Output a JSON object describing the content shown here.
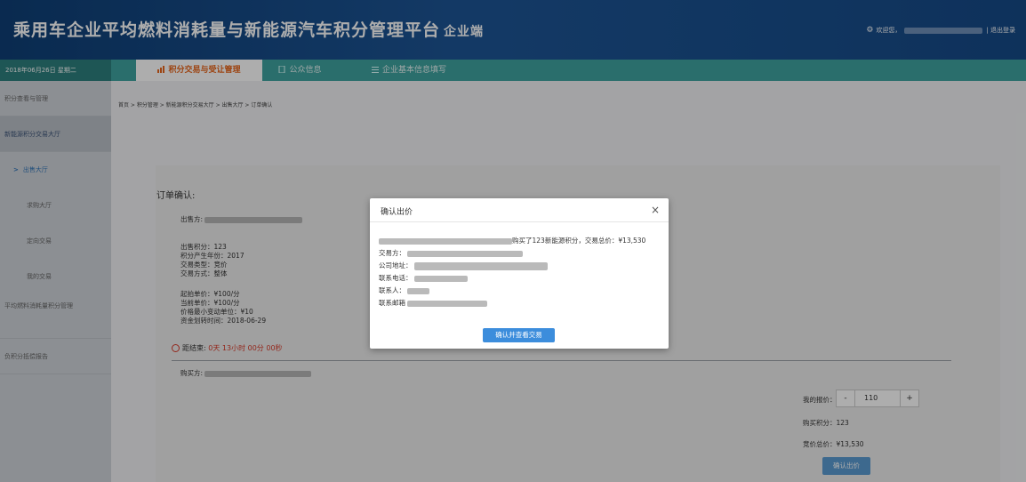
{
  "header": {
    "title": "乘用车企业平均燃料消耗量与新能源汽车积分管理平台",
    "subtitle": "企业端",
    "welcome": "欢迎您，",
    "logout": "| 退出登录"
  },
  "nav": {
    "date": "2018年06月26日 星期二",
    "tabs": [
      {
        "label": "积分交易与受让管理"
      },
      {
        "label": "公众信息"
      },
      {
        "label": "企业基本信息填写"
      }
    ]
  },
  "sidebar": {
    "items": [
      "积分查看与管理",
      "新能源积分交易大厅",
      "出售大厅",
      "求购大厅",
      "定向交易",
      "我的交易",
      "平均燃料消耗量积分管理",
      "负积分抵偿报告"
    ]
  },
  "breadcrumb": "首页 > 积分管理 > 新能源积分交易大厅 > 出售大厅 > 订单确认",
  "order": {
    "heading": "订单确认:",
    "seller_label": "出售方:",
    "credits": "出售积分：123",
    "year": "积分产生年份：2017",
    "trade_type": "交易类型：竞价",
    "trade_mode": "交易方式：整体",
    "start_price": "起拍单价：¥100/分",
    "current_price": "当前单价：¥100/分",
    "min_step": "价格最小变动单位：¥10",
    "transfer_time": "资金划转时间：2018-06-29",
    "countdown_label": "距结束:",
    "countdown_days": "0天",
    "countdown_hours": "13小时",
    "countdown_minutes": "00分",
    "countdown_seconds": "00秒",
    "buyer_label": "购买方:"
  },
  "bid": {
    "my_bid_label": "我的报价：",
    "minus": "-",
    "value": "110",
    "plus": "+",
    "buy_credits": "购买积分：123",
    "total": "竞价总价：¥13,530",
    "confirm_button": "确认出价"
  },
  "modal": {
    "title": "确认出价",
    "close": "×",
    "summary": "购买了123新能源积分，交易总价：¥13,530",
    "trade_party": "交易方：",
    "address": "公司地址：",
    "phone": "联系电话：",
    "contact": "联系人：",
    "email": "联系邮箱",
    "confirm_button": "确认并查看交易"
  }
}
